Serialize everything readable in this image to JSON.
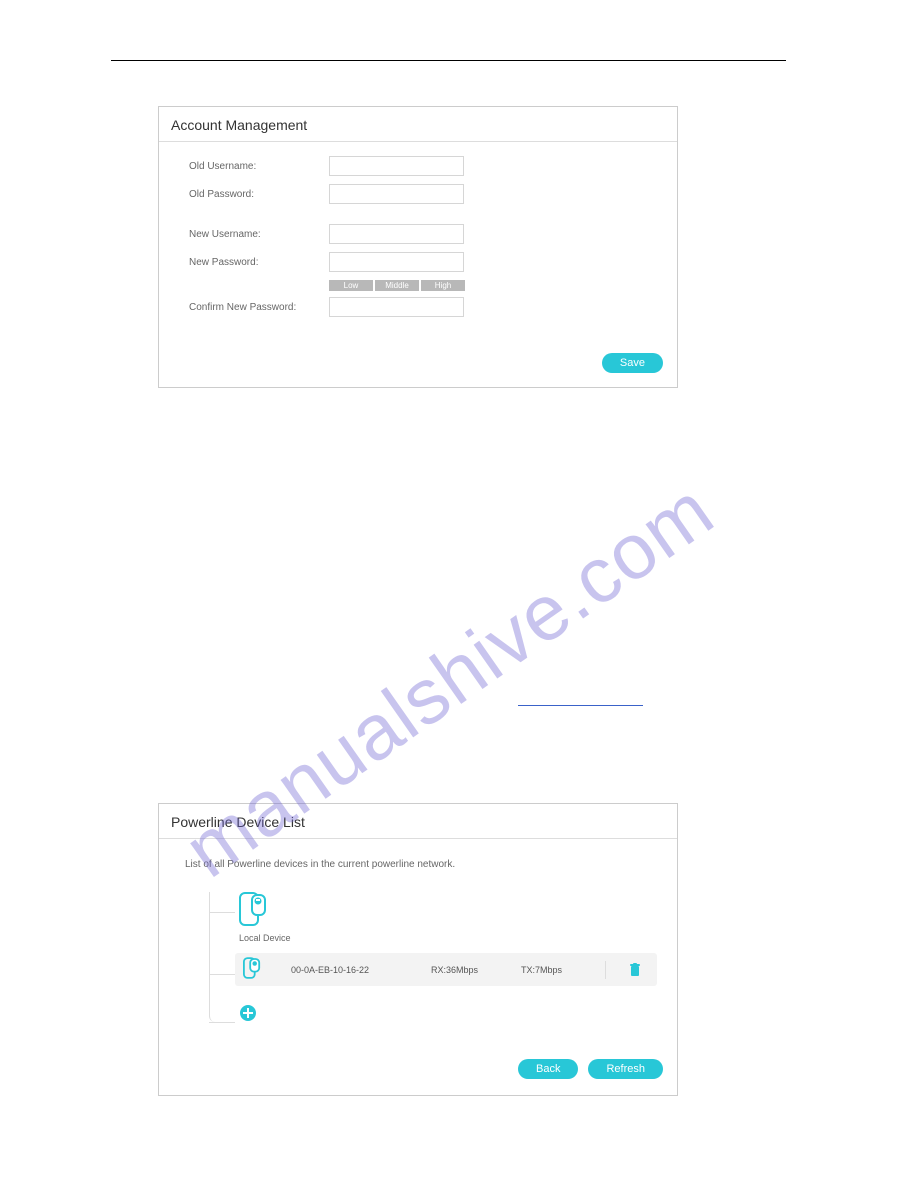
{
  "watermark": "manualshive.com",
  "account_panel": {
    "title": "Account Management",
    "labels": {
      "old_username": "Old Username:",
      "old_password": "Old Password:",
      "new_username": "New Username:",
      "new_password": "New Password:",
      "confirm_new_password": "Confirm New Password:"
    },
    "strength": {
      "low": "Low",
      "middle": "Middle",
      "high": "High"
    },
    "save_label": "Save"
  },
  "powerline_panel": {
    "title": "Powerline Device List",
    "description": "List of all Powerline devices in the current powerline network.",
    "local_device_label": "Local Device",
    "device": {
      "mac": "00-0A-EB-10-16-22",
      "rx": "RX:36Mbps",
      "tx": "TX:7Mbps"
    },
    "back_label": "Back",
    "refresh_label": "Refresh"
  },
  "colors": {
    "accent": "#28c7d7"
  }
}
